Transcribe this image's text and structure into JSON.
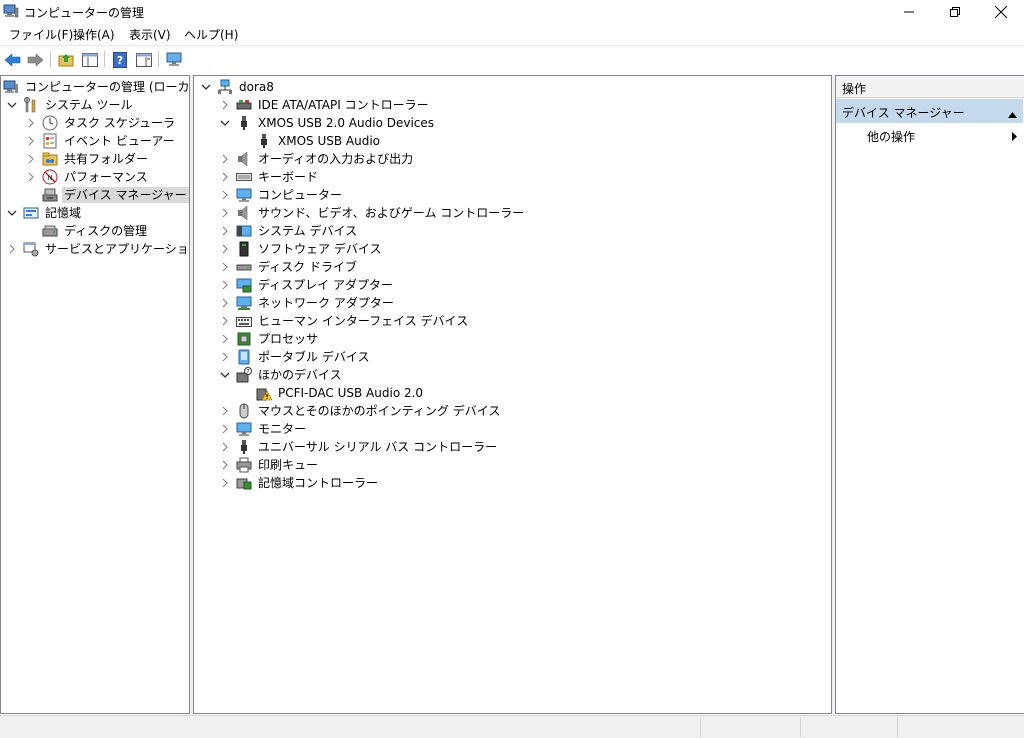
{
  "window": {
    "title": "コンピューターの管理"
  },
  "menu": [
    "ファイル(F)",
    "操作(A)",
    "表示(V)",
    "ヘルプ(H)"
  ],
  "toolbar": {
    "buttons": [
      "back-icon",
      "forward-icon",
      "up-folder-icon",
      "show-hide-tree-icon",
      "help-icon",
      "properties-icon",
      "monitor-icon"
    ]
  },
  "left_tree": {
    "root": "コンピューターの管理 (ローカル)",
    "system_tools": "システム ツール",
    "task_scheduler": "タスク スケジューラ",
    "event_viewer": "イベント ビューアー",
    "shared_folders": "共有フォルダー",
    "performance": "パフォーマンス",
    "device_manager": "デバイス マネージャー",
    "storage": "記憶域",
    "disk_management": "ディスクの管理",
    "services_apps": "サービスとアプリケーション"
  },
  "device_tree": {
    "computer": "dora8",
    "categories": [
      {
        "label": "IDE ATA/ATAPI コントローラー",
        "icon": "ide-controller-icon",
        "expanded": false
      },
      {
        "label": "XMOS USB 2.0 Audio Devices",
        "icon": "usb-device-icon",
        "expanded": true
      },
      {
        "label": "XMOS USB Audio",
        "icon": "usb-device-icon",
        "child": true
      },
      {
        "label": "オーディオの入力および出力",
        "icon": "speaker-icon",
        "expanded": false
      },
      {
        "label": "キーボード",
        "icon": "keyboard-icon",
        "expanded": false
      },
      {
        "label": "コンピューター",
        "icon": "computer-icon",
        "expanded": false
      },
      {
        "label": "サウンド、ビデオ、およびゲーム コントローラー",
        "icon": "speaker-icon",
        "expanded": false
      },
      {
        "label": "システム デバイス",
        "icon": "system-device-icon",
        "expanded": false
      },
      {
        "label": "ソフトウェア デバイス",
        "icon": "software-device-icon",
        "expanded": false
      },
      {
        "label": "ディスク ドライブ",
        "icon": "disk-drive-icon",
        "expanded": false
      },
      {
        "label": "ディスプレイ アダプター",
        "icon": "display-adapter-icon",
        "expanded": false
      },
      {
        "label": "ネットワーク アダプター",
        "icon": "network-adapter-icon",
        "expanded": false
      },
      {
        "label": "ヒューマン インターフェイス デバイス",
        "icon": "hid-icon",
        "expanded": false
      },
      {
        "label": "プロセッサ",
        "icon": "processor-icon",
        "expanded": false
      },
      {
        "label": "ポータブル デバイス",
        "icon": "portable-device-icon",
        "expanded": false
      },
      {
        "label": "ほかのデバイス",
        "icon": "other-device-icon",
        "expanded": true
      },
      {
        "label": "PCFI-DAC USB Audio 2.0",
        "icon": "warning-device-icon",
        "child": true
      },
      {
        "label": "マウスとそのほかのポインティング デバイス",
        "icon": "mouse-icon",
        "expanded": false
      },
      {
        "label": "モニター",
        "icon": "monitor-icon",
        "expanded": false
      },
      {
        "label": "ユニバーサル シリアル バス コントローラー",
        "icon": "usb-device-icon",
        "expanded": false
      },
      {
        "label": "印刷キュー",
        "icon": "printer-icon",
        "expanded": false
      },
      {
        "label": "記憶域コントローラー",
        "icon": "storage-controller-icon",
        "expanded": false
      }
    ]
  },
  "actions": {
    "header": "操作",
    "section": "デバイス マネージャー",
    "item": "他の操作"
  },
  "colors": {
    "selection": "#d9d9d9",
    "actions_section": "#c5d9ed",
    "accent": "#1e7bd8"
  }
}
